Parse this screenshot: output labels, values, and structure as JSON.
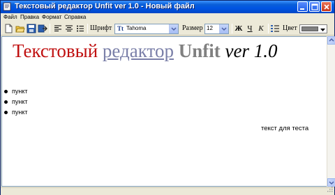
{
  "window": {
    "title": "Текстовый редактор Unfit ver 1.0 - Новый файл"
  },
  "menu": {
    "items": [
      "Файл",
      "Правка",
      "Формат",
      "Справка"
    ]
  },
  "toolbar": {
    "font_label": "Шрифт",
    "font_value": "Tahoma",
    "size_label": "Размер",
    "size_value": "12",
    "bold_label": "Ж",
    "underline_label": "Ч",
    "italic_label": "К",
    "color_label": "Цвет",
    "color_value": "#808080"
  },
  "document": {
    "heading": {
      "word1": "Текстовый",
      "word2": "редактор",
      "word3": "Unfit",
      "word4": "ver 1.0"
    },
    "bullets": [
      "пункт",
      "пункт",
      "пункт"
    ],
    "test_text": "текст для теста"
  },
  "colors": {
    "title_bar": "#0054e3",
    "heading_red": "#c01010",
    "heading_blue": "#7a7fa8",
    "heading_gray": "#808080"
  }
}
